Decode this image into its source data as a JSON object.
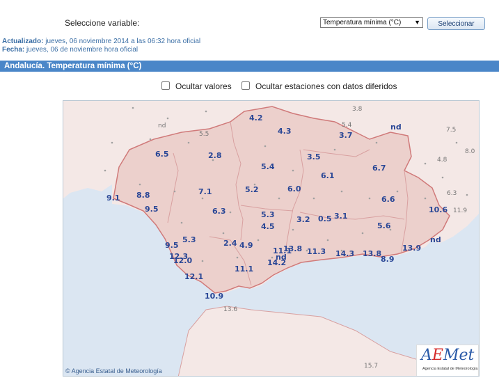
{
  "header": {
    "select_label": "Seleccione variable:",
    "select_value": "Temperatura mínima (°C)",
    "select_button": "Seleccionar"
  },
  "update": {
    "actualizado_label": "Actualizado:",
    "actualizado_value": "jueves, 06 noviembre 2014 a las 06:32 hora oficial",
    "fecha_label": "Fecha:",
    "fecha_value": "jueves, 06 de noviembre hora oficial"
  },
  "title": "Andalucía. Temperatura mínima (°C)",
  "options": {
    "hide_values": "Ocultar valores",
    "hide_deferred": "Ocultar estaciones con datos diferidos"
  },
  "map": {
    "copyright": "Agencia Estatal de Meteorología",
    "logo_sub": "Agencia Estatal de Meteorología",
    "colors": {
      "sea": "#dbe6f2",
      "land": "#f4e8e6",
      "border": "#d28a8a",
      "value": "#2a4796"
    },
    "values": [
      "4.2",
      "4.3",
      "3.7",
      "nd",
      "6.5",
      "2.8",
      "3.5",
      "5.4",
      "6.1",
      "6.7",
      "9.1",
      "8.8",
      "7.1",
      "5.2",
      "6.0",
      "9.5",
      "6.3",
      "5.3",
      "6.6",
      "10.6",
      "3.2",
      "0.5",
      "3.1",
      "4.5",
      "5.6",
      "5.3",
      "2.4",
      "4.9",
      "9.5",
      "nd",
      "11.1",
      "13.8",
      "11.3",
      "14.3",
      "13.8",
      "13.9",
      "12.3",
      "12.0",
      "14.2",
      "8.9",
      "11.1",
      "12.1",
      "10.9",
      "nd"
    ],
    "grey_values": [
      "nd",
      "3.8",
      "5.5",
      "5.4",
      "7.5",
      "8.0",
      "4.8",
      "6.3",
      "11.9",
      "13.6",
      "15.7"
    ]
  }
}
